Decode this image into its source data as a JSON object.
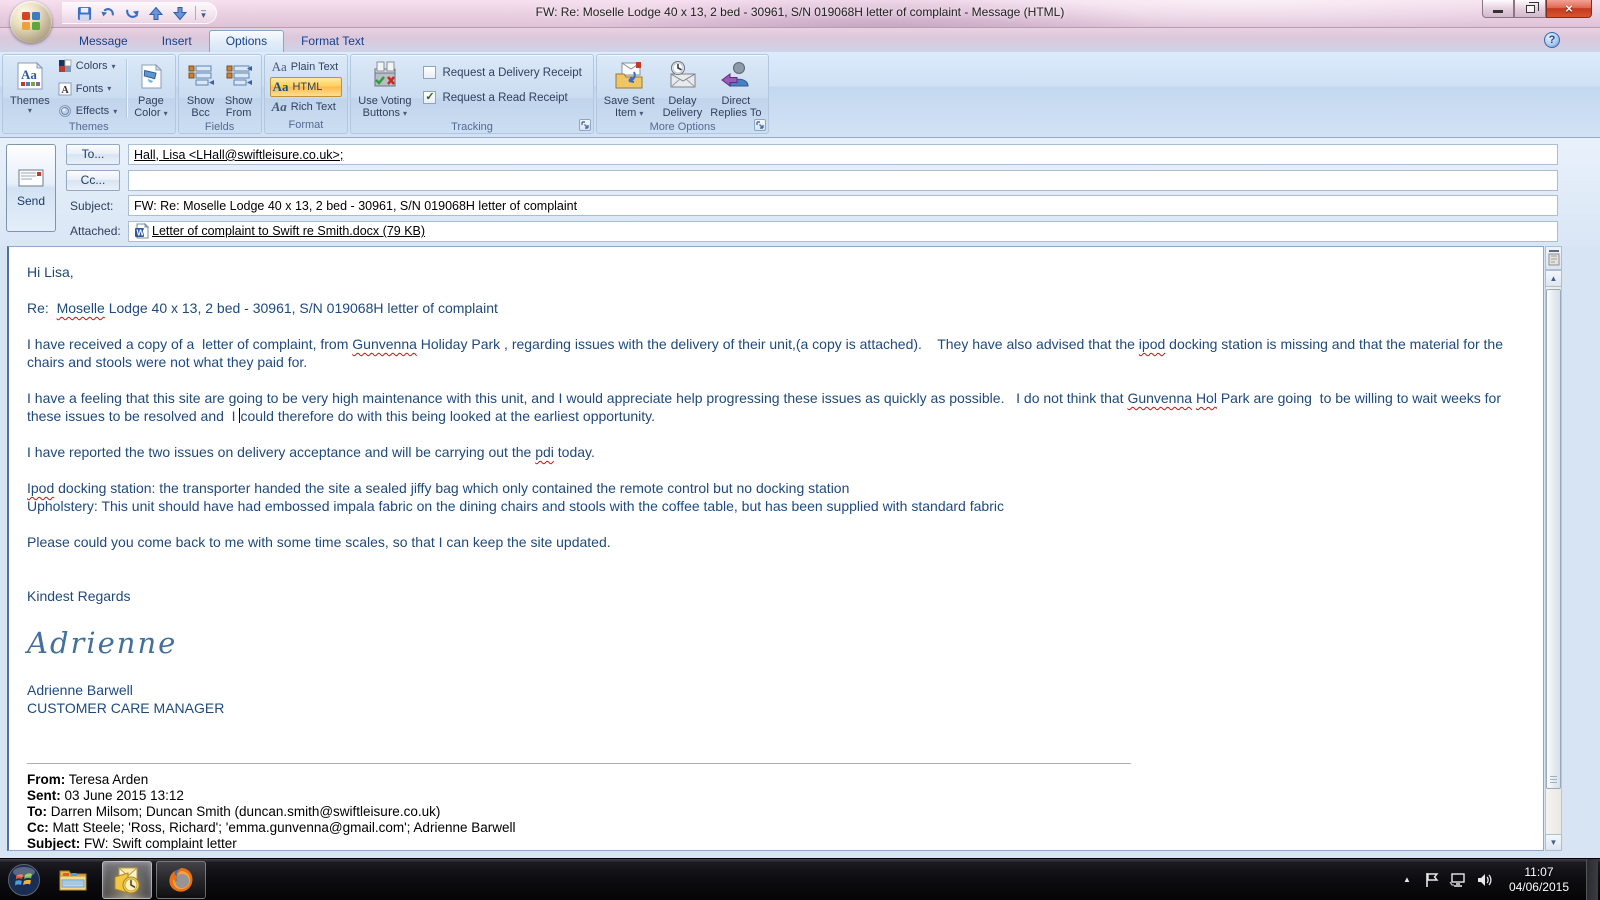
{
  "window": {
    "title": "FW: Re:  Moselle Lodge 40 x 13, 2 bed - 30961, S/N 019068H letter of complaint  -  Message (HTML)"
  },
  "glyphs": {
    "dropdown": "▾",
    "up_arrow": "▲",
    "down_arrow": "▼",
    "check": "✓",
    "help": "?",
    "close": "×",
    "tray_expand": "▲"
  },
  "ribbon": {
    "tabs": [
      {
        "label": "Message",
        "active": false
      },
      {
        "label": "Insert",
        "active": false
      },
      {
        "label": "Options",
        "active": true
      },
      {
        "label": "Format Text",
        "active": false
      }
    ],
    "themes": {
      "caption": "Themes",
      "themes_button": "Themes",
      "colors": "Colors",
      "fonts": "Fonts",
      "effects": "Effects",
      "page_color_line1": "Page",
      "page_color_line2": "Color"
    },
    "fields": {
      "caption": "Fields",
      "show_bcc_line1": "Show",
      "show_bcc_line2": "Bcc",
      "show_from_line1": "Show",
      "show_from_line2": "From"
    },
    "format": {
      "caption": "Format",
      "plain_text": "Plain Text",
      "html": "HTML",
      "rich_text": "Rich Text",
      "aa": "Aa"
    },
    "tracking": {
      "caption": "Tracking",
      "use_voting_line1": "Use Voting",
      "use_voting_line2": "Buttons",
      "delivery_receipt": "Request a Delivery Receipt",
      "read_receipt": "Request a Read Receipt",
      "delivery_checked": false,
      "read_checked": true
    },
    "more_options": {
      "caption": "More Options",
      "save_sent_line1": "Save Sent",
      "save_sent_line2": "Item",
      "delay_line1": "Delay",
      "delay_line2": "Delivery",
      "direct_line1": "Direct",
      "direct_line2": "Replies To"
    }
  },
  "envelope": {
    "send": "Send",
    "to_button": "To...",
    "cc_button": "Cc...",
    "subject_label": "Subject:",
    "attached_label": "Attached:",
    "to_value": "Hall, Lisa <LHall@swiftleisure.co.uk>;",
    "cc_value": "",
    "subject_value": "FW: Re:  Moselle Lodge 40 x 13, 2 bed - 30961, S/N 019068H letter of complaint",
    "attachment_name": "Letter of complaint to Swift re Smith.docx (79 KB)"
  },
  "body": {
    "text_color": "#1f497d",
    "paragraphs": [
      [
        {
          "t": "Hi Lisa,"
        }
      ],
      [],
      [
        {
          "t": "Re:  "
        },
        {
          "t": "Moselle",
          "sq": true
        },
        {
          "t": " Lodge 40 x 13, 2 bed - 30961, S/N 019068H letter of complaint"
        }
      ],
      [],
      [
        {
          "t": "I have received a copy of a  letter of complaint, from "
        },
        {
          "t": "Gunvenna",
          "sq": true
        },
        {
          "t": " Holiday Park , regarding issues with the delivery of their unit,(a copy is attached).    They have also advised that the "
        },
        {
          "t": "ipod",
          "sq": true
        },
        {
          "t": " docking station is missing and that the material for the chairs and stools were not what they paid for."
        }
      ],
      [],
      [
        {
          "t": "I have a feeling that this site are going to be very high maintenance with this unit, and I would appreciate help progressing these issues as quickly as possible.   I do not think that "
        },
        {
          "t": "Gunvenna",
          "sq": true
        },
        {
          "t": " "
        },
        {
          "t": "Hol",
          "sq": true
        },
        {
          "t": " Park are going  to be willing to wait weeks for these issues to be resolved and  I "
        },
        {
          "caret": true
        },
        {
          "t": "could therefore do with this being looked at the earliest opportunity."
        }
      ],
      [],
      [
        {
          "t": "I have reported the two issues on delivery acceptance and will be carrying out the "
        },
        {
          "t": "pdi",
          "sq": true
        },
        {
          "t": " today."
        }
      ],
      [],
      [
        {
          "t": "Ipod",
          "sq": true
        },
        {
          "t": " docking station: the transporter handed the site a sealed jiffy bag which only contained the remote control but no docking station"
        }
      ],
      [
        {
          "t": "Upholstery: This unit should have had embossed impala fabric on the dining chairs and stools with the coffee table, but has been supplied with standard fabric"
        }
      ],
      [],
      [
        {
          "t": "Please could you come back to me with some time scales, so that I can keep the site updated."
        }
      ],
      [],
      [],
      [
        {
          "t": "Kindest Regards"
        }
      ],
      [],
      [
        {
          "t": "Adrienne",
          "script": true
        }
      ],
      [],
      [
        {
          "t": "Adrienne Barwell"
        }
      ],
      [
        {
          "t": "CUSTOMER CARE MANAGER"
        }
      ],
      [],
      []
    ],
    "quoted": {
      "rows": [
        {
          "label": "From:",
          "value": " Teresa Arden"
        },
        {
          "label": "Sent:",
          "value": " 03 June 2015 13:12"
        },
        {
          "label": "To:",
          "value": " Darren Milsom; Duncan Smith (duncan.smith@swiftleisure.co.uk)"
        },
        {
          "label": "Cc:",
          "value": " Matt Steele; 'Ross, Richard'; 'emma.gunvenna@gmail.com'; Adrienne Barwell"
        },
        {
          "label": "Subject:",
          "value": " FW: Swift complaint letter"
        }
      ]
    }
  },
  "taskbar": {
    "time": "11:07",
    "date": "04/06/2015"
  }
}
